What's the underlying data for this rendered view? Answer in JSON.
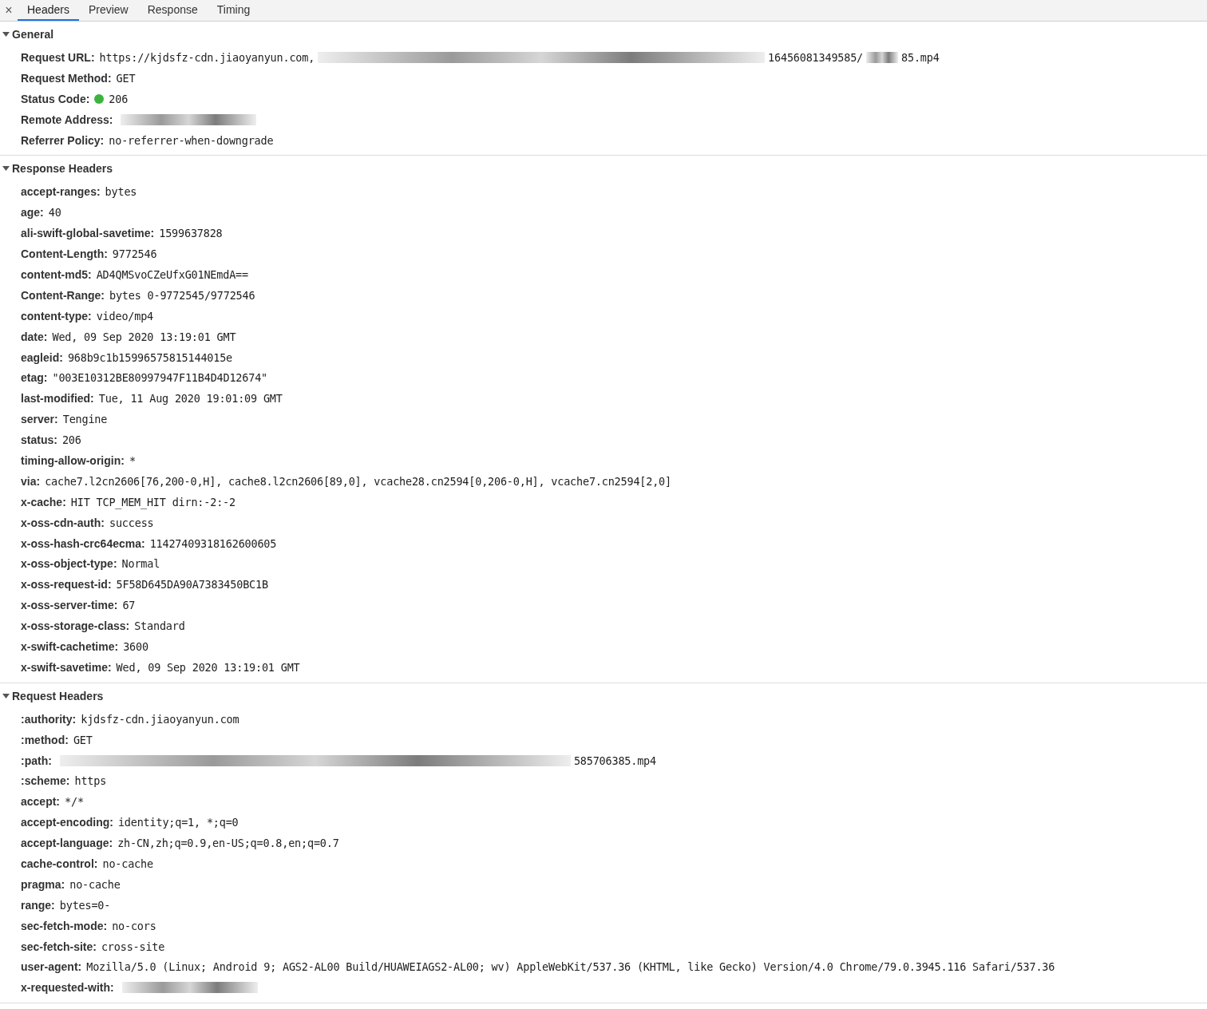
{
  "close_icon": "×",
  "tabs": [
    {
      "label": "Headers",
      "selected": true
    },
    {
      "label": "Preview",
      "selected": false
    },
    {
      "label": "Response",
      "selected": false
    },
    {
      "label": "Timing",
      "selected": false
    }
  ],
  "sections": [
    {
      "title": "General",
      "expanded": true,
      "rows": [
        {
          "key": "Request URL:",
          "parts": [
            {
              "kind": "text",
              "text": "https://kjdsfz-cdn.jiaoyanyun.com,"
            },
            {
              "kind": "redacted"
            },
            {
              "kind": "text",
              "text": "16456081349585/"
            },
            {
              "kind": "redacted"
            },
            {
              "kind": "text",
              "text": "85.mp4"
            }
          ]
        },
        {
          "key": "Request Method:",
          "parts": [
            {
              "kind": "text",
              "text": "GET"
            }
          ]
        },
        {
          "key": "Status Code:",
          "parts": [
            {
              "kind": "status",
              "color": "#3cb43c"
            },
            {
              "kind": "text",
              "text": "206"
            }
          ]
        },
        {
          "key": "Remote Address:",
          "parts": [
            {
              "kind": "redacted"
            }
          ]
        },
        {
          "key": "Referrer Policy:",
          "parts": [
            {
              "kind": "text",
              "text": "no-referrer-when-downgrade"
            }
          ]
        }
      ]
    },
    {
      "title": "Response Headers",
      "expanded": true,
      "rows": [
        {
          "key": "accept-ranges:",
          "parts": [
            {
              "kind": "text",
              "text": "bytes"
            }
          ]
        },
        {
          "key": "age:",
          "parts": [
            {
              "kind": "text",
              "text": "40"
            }
          ]
        },
        {
          "key": "ali-swift-global-savetime:",
          "parts": [
            {
              "kind": "text",
              "text": "1599637828"
            }
          ]
        },
        {
          "key": "Content-Length:",
          "parts": [
            {
              "kind": "text",
              "text": "9772546"
            }
          ]
        },
        {
          "key": "content-md5:",
          "parts": [
            {
              "kind": "text",
              "text": "AD4QMSvoCZeUfxG01NEmdA=="
            }
          ]
        },
        {
          "key": "Content-Range:",
          "parts": [
            {
              "kind": "text",
              "text": "bytes 0-9772545/9772546"
            }
          ]
        },
        {
          "key": "content-type:",
          "parts": [
            {
              "kind": "text",
              "text": "video/mp4"
            }
          ]
        },
        {
          "key": "date:",
          "parts": [
            {
              "kind": "text",
              "text": "Wed, 09 Sep 2020 13:19:01 GMT"
            }
          ]
        },
        {
          "key": "eagleid:",
          "parts": [
            {
              "kind": "text",
              "text": "968b9c1b15996575815144015e"
            }
          ]
        },
        {
          "key": "etag:",
          "parts": [
            {
              "kind": "text",
              "text": "\"003E10312BE80997947F11B4D4D12674\""
            }
          ]
        },
        {
          "key": "last-modified:",
          "parts": [
            {
              "kind": "text",
              "text": "Tue, 11 Aug 2020 19:01:09 GMT"
            }
          ]
        },
        {
          "key": "server:",
          "parts": [
            {
              "kind": "text",
              "text": "Tengine"
            }
          ]
        },
        {
          "key": "status:",
          "parts": [
            {
              "kind": "text",
              "text": "206"
            }
          ]
        },
        {
          "key": "timing-allow-origin:",
          "parts": [
            {
              "kind": "text",
              "text": "*"
            }
          ]
        },
        {
          "key": "via:",
          "parts": [
            {
              "kind": "text",
              "text": "cache7.l2cn2606[76,200-0,H], cache8.l2cn2606[89,0], vcache28.cn2594[0,206-0,H], vcache7.cn2594[2,0]"
            }
          ]
        },
        {
          "key": "x-cache:",
          "parts": [
            {
              "kind": "text",
              "text": "HIT TCP_MEM_HIT dirn:-2:-2"
            }
          ]
        },
        {
          "key": "x-oss-cdn-auth:",
          "parts": [
            {
              "kind": "text",
              "text": "success"
            }
          ]
        },
        {
          "key": "x-oss-hash-crc64ecma:",
          "parts": [
            {
              "kind": "text",
              "text": "11427409318162600605"
            }
          ]
        },
        {
          "key": "x-oss-object-type:",
          "parts": [
            {
              "kind": "text",
              "text": "Normal"
            }
          ]
        },
        {
          "key": "x-oss-request-id:",
          "parts": [
            {
              "kind": "text",
              "text": "5F58D645DA90A7383450BC1B"
            }
          ]
        },
        {
          "key": "x-oss-server-time:",
          "parts": [
            {
              "kind": "text",
              "text": "67"
            }
          ]
        },
        {
          "key": "x-oss-storage-class:",
          "parts": [
            {
              "kind": "text",
              "text": "Standard"
            }
          ]
        },
        {
          "key": "x-swift-cachetime:",
          "parts": [
            {
              "kind": "text",
              "text": "3600"
            }
          ]
        },
        {
          "key": "x-swift-savetime:",
          "parts": [
            {
              "kind": "text",
              "text": "Wed, 09 Sep 2020 13:19:01 GMT"
            }
          ]
        }
      ]
    },
    {
      "title": "Request Headers",
      "expanded": true,
      "rows": [
        {
          "key": ":authority:",
          "parts": [
            {
              "kind": "text",
              "text": "kjdsfz-cdn.jiaoyanyun.com"
            }
          ]
        },
        {
          "key": ":method:",
          "parts": [
            {
              "kind": "text",
              "text": "GET"
            }
          ]
        },
        {
          "key": ":path:",
          "parts": [
            {
              "kind": "redacted"
            },
            {
              "kind": "text",
              "text": "585706385.mp4"
            }
          ]
        },
        {
          "key": ":scheme:",
          "parts": [
            {
              "kind": "text",
              "text": "https"
            }
          ]
        },
        {
          "key": "accept:",
          "parts": [
            {
              "kind": "text",
              "text": "*/*"
            }
          ]
        },
        {
          "key": "accept-encoding:",
          "parts": [
            {
              "kind": "text",
              "text": "identity;q=1, *;q=0"
            }
          ]
        },
        {
          "key": "accept-language:",
          "parts": [
            {
              "kind": "text",
              "text": "zh-CN,zh;q=0.9,en-US;q=0.8,en;q=0.7"
            }
          ]
        },
        {
          "key": "cache-control:",
          "parts": [
            {
              "kind": "text",
              "text": "no-cache"
            }
          ]
        },
        {
          "key": "pragma:",
          "parts": [
            {
              "kind": "text",
              "text": "no-cache"
            }
          ]
        },
        {
          "key": "range:",
          "parts": [
            {
              "kind": "text",
              "text": "bytes=0-"
            }
          ]
        },
        {
          "key": "sec-fetch-mode:",
          "parts": [
            {
              "kind": "text",
              "text": "no-cors"
            }
          ]
        },
        {
          "key": "sec-fetch-site:",
          "parts": [
            {
              "kind": "text",
              "text": "cross-site"
            }
          ]
        },
        {
          "key": "user-agent:",
          "parts": [
            {
              "kind": "text",
              "text": "Mozilla/5.0 (Linux; Android 9; AGS2-AL00 Build/HUAWEIAGS2-AL00; wv) AppleWebKit/537.36 (KHTML, like Gecko) Version/4.0 Chrome/79.0.3945.116 Safari/537.36"
            }
          ]
        },
        {
          "key": "x-requested-with:",
          "parts": [
            {
              "kind": "redacted"
            }
          ]
        }
      ]
    }
  ]
}
